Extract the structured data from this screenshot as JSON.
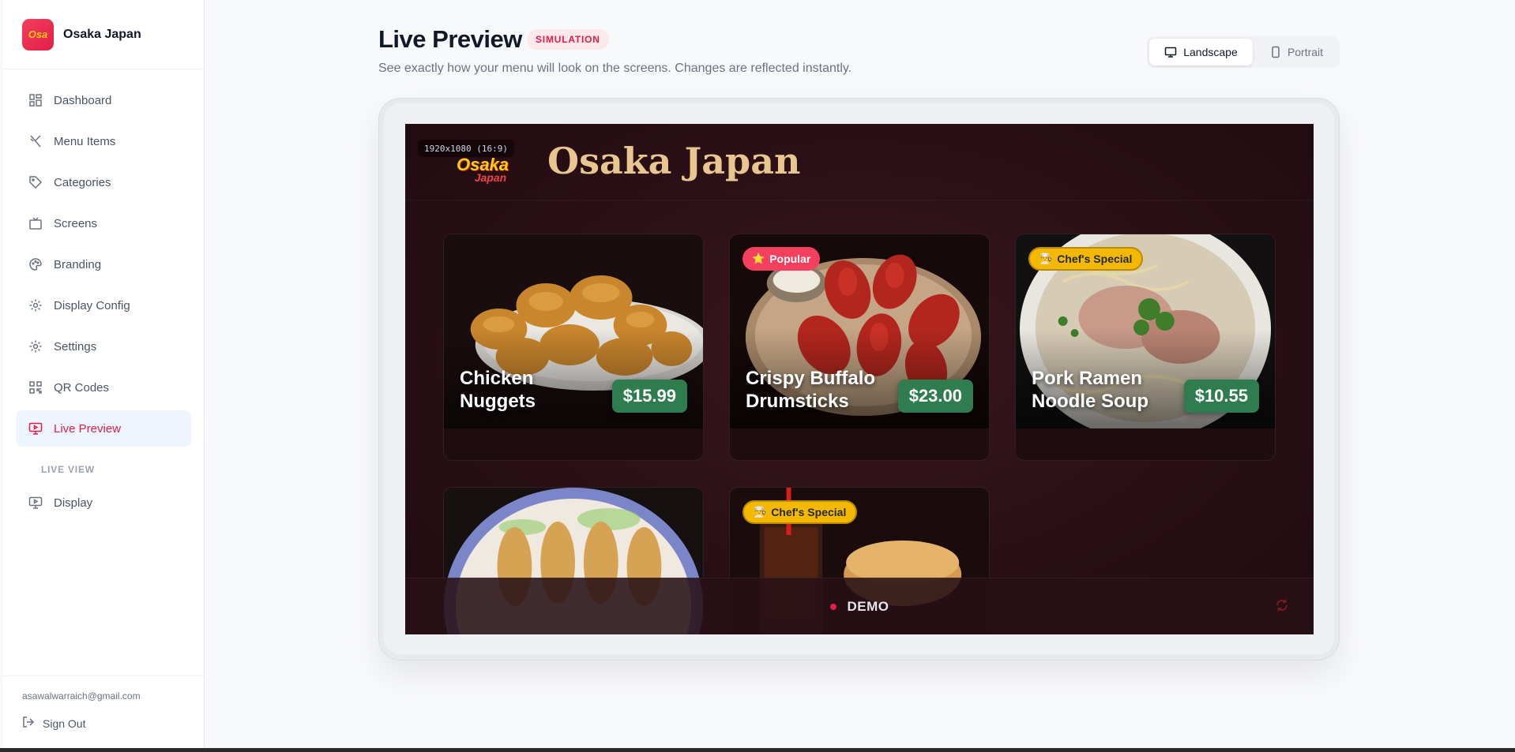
{
  "brand": {
    "name": "Osaka Japan",
    "logo_text": "Osa"
  },
  "sidebar": {
    "items": [
      {
        "label": "Dashboard",
        "icon": "dashboard-icon"
      },
      {
        "label": "Menu Items",
        "icon": "utensils-icon"
      },
      {
        "label": "Categories",
        "icon": "tag-icon"
      },
      {
        "label": "Screens",
        "icon": "tv-icon"
      },
      {
        "label": "Branding",
        "icon": "palette-icon"
      },
      {
        "label": "Display Config",
        "icon": "gear-icon"
      },
      {
        "label": "Settings",
        "icon": "gear-icon"
      },
      {
        "label": "QR Codes",
        "icon": "qr-icon"
      },
      {
        "label": "Live Preview",
        "icon": "monitor-play-icon",
        "active": true
      }
    ],
    "section_label": "LIVE VIEW",
    "section_items": [
      {
        "label": "Display",
        "icon": "monitor-icon"
      }
    ],
    "footer": {
      "email": "asawalwarraich@gmail.com",
      "signout_label": "Sign Out"
    }
  },
  "header": {
    "title": "Live Preview",
    "badge": "SIMULATION",
    "subtitle": "See exactly how your menu will look on the screens. Changes are reflected instantly.",
    "orientation": {
      "landscape": "Landscape",
      "portrait": "Portrait",
      "selected": "Landscape"
    }
  },
  "preview": {
    "resolution": "1920x1080 (16:9)",
    "logo_line1": "Osaka",
    "logo_line2": "Japan",
    "title": "Osaka Japan",
    "items": [
      {
        "name": "Chicken Nuggets",
        "price": "$15.99",
        "badge": ""
      },
      {
        "name": "Crispy Buffalo Drumsticks",
        "price": "$23.00",
        "badge": "Popular",
        "badge_icon": "⭐"
      },
      {
        "name": "Pork Ramen Noodle Soup",
        "price": "$10.55",
        "badge": "Chef's Special",
        "badge_icon": "👨‍🍳"
      },
      {
        "name": "",
        "price": "",
        "badge": ""
      },
      {
        "name": "",
        "price": "",
        "badge": "Chef's Special",
        "badge_icon": "👨‍🍳"
      }
    ],
    "footer_text": "DEMO"
  },
  "colors": {
    "accent": "#e11d48",
    "price_green": "#2f7d4f",
    "chef_badge": "#f5b800",
    "screen_bg": "#2a0f16",
    "title_gold": "#e8c68f"
  }
}
